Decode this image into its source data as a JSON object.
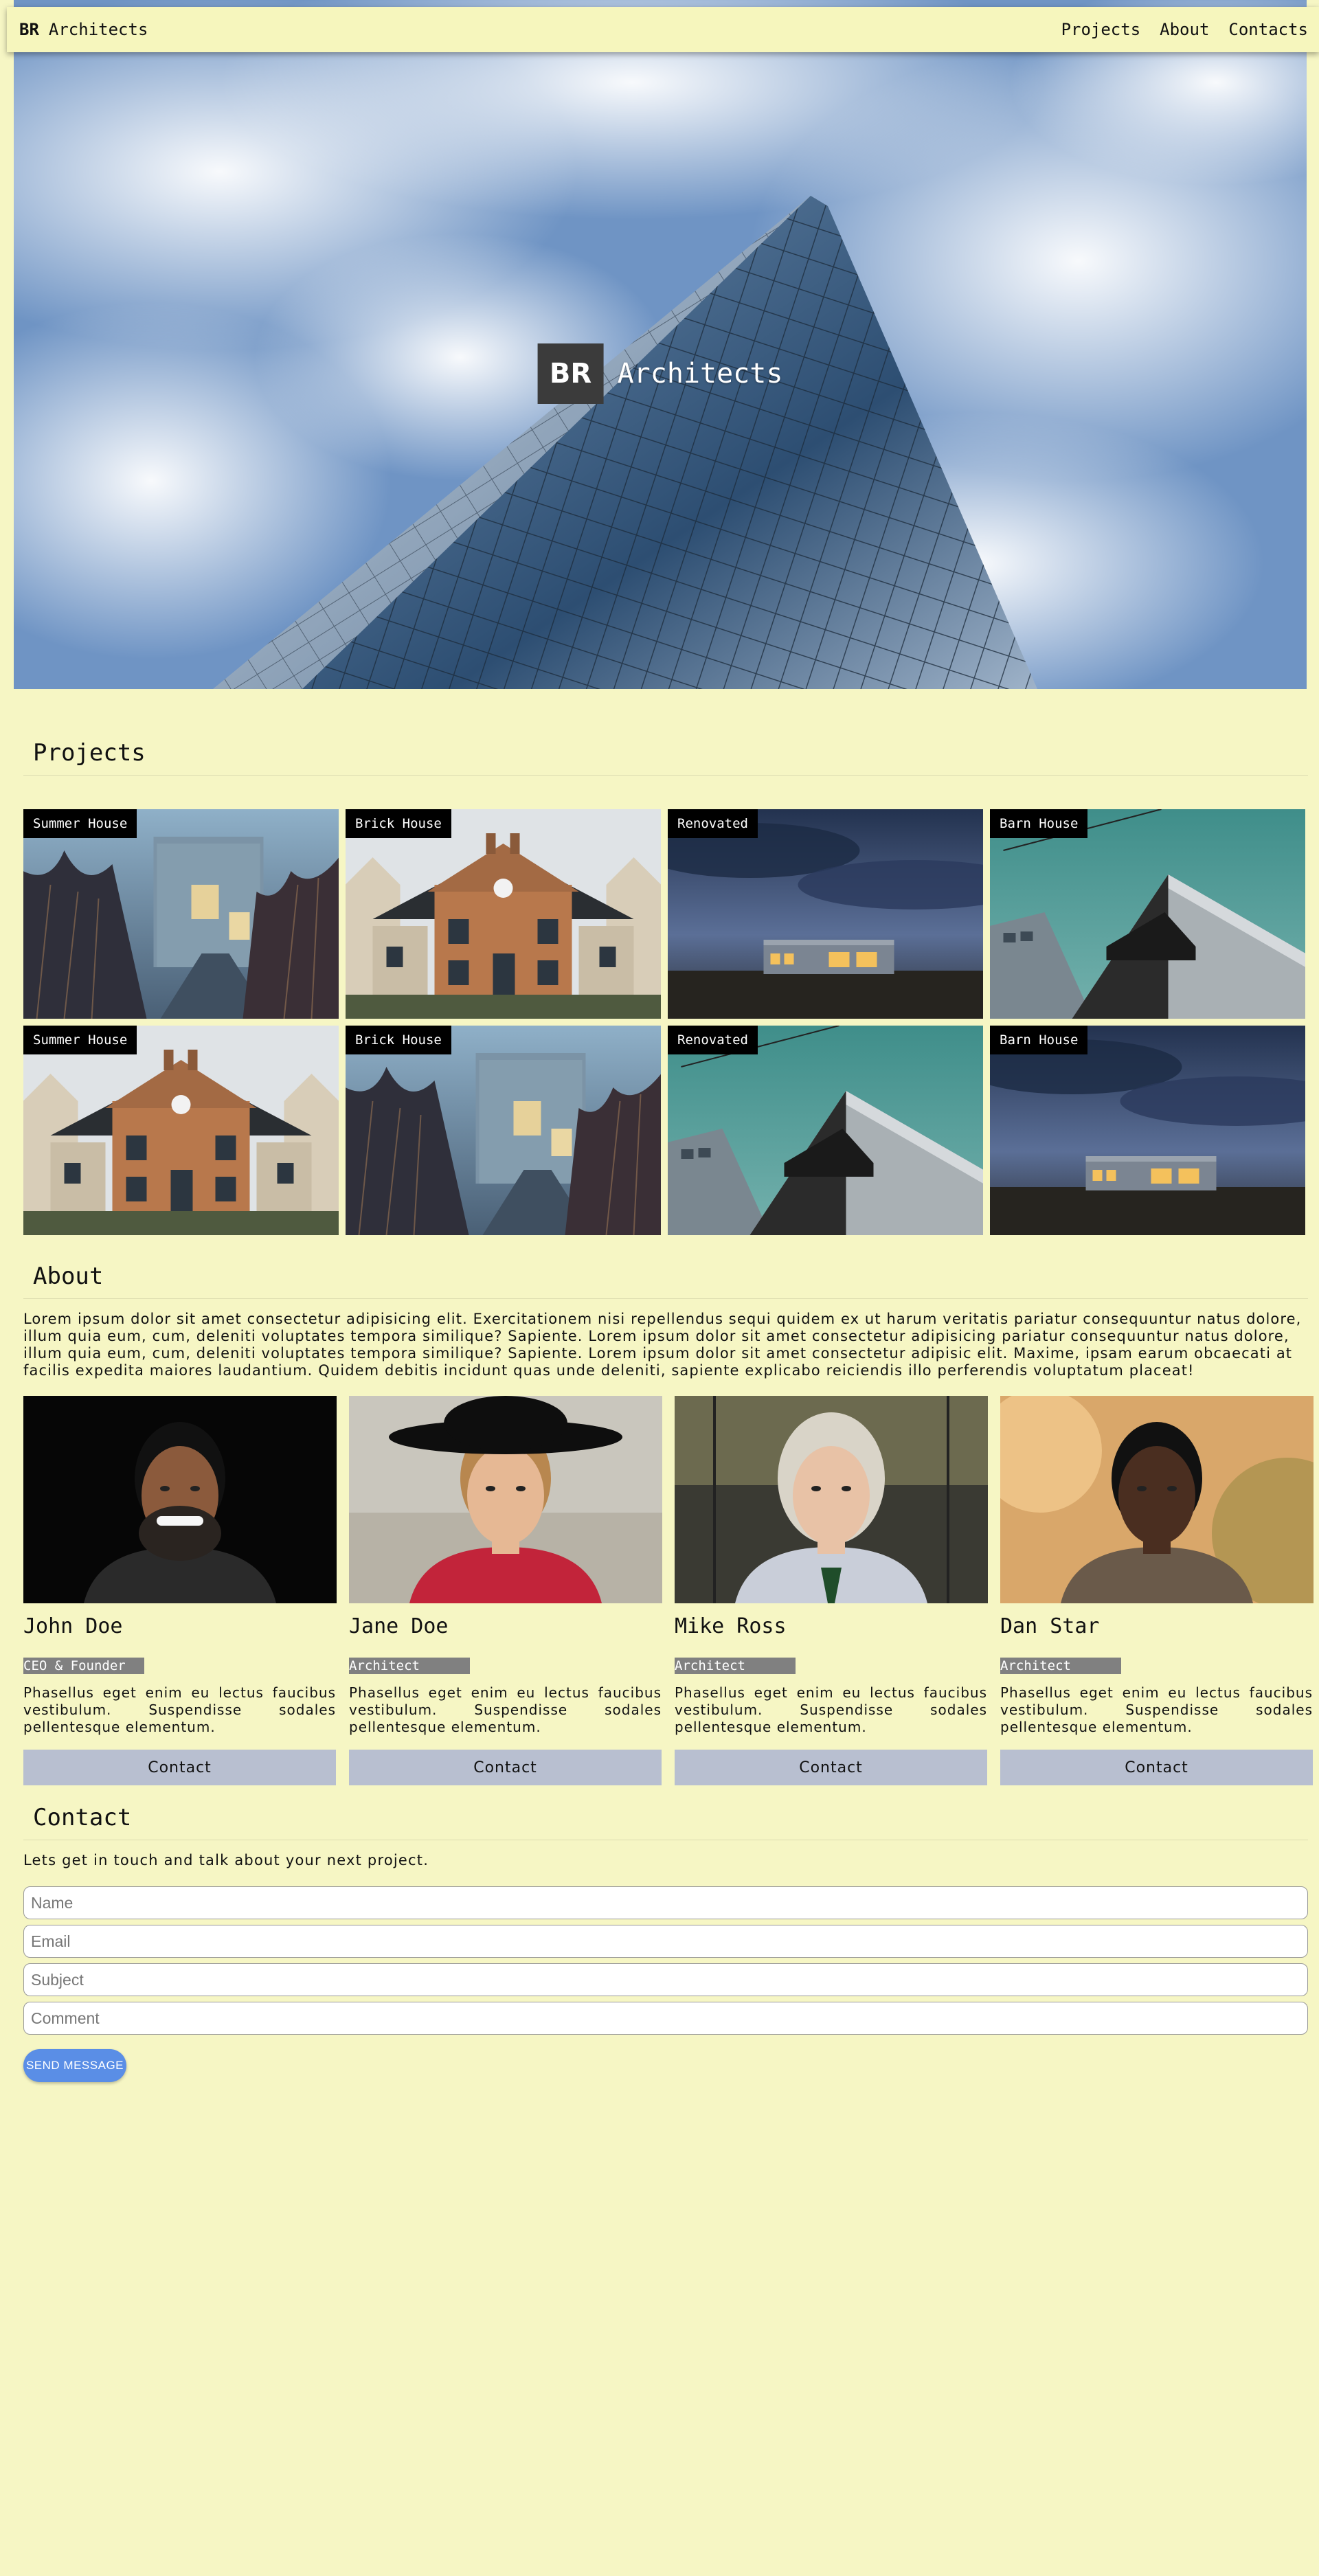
{
  "nav": {
    "brand_mark": "BR",
    "brand_name": "Architects",
    "links": [
      "Projects",
      "About",
      "Contacts"
    ]
  },
  "hero": {
    "mark": "BR",
    "title": "Architects"
  },
  "projects": {
    "title": "Projects",
    "tiles": [
      {
        "label": "Summer House",
        "image": "modern-house-path-photo"
      },
      {
        "label": "Brick House",
        "image": "brick-house-photo"
      },
      {
        "label": "Renovated",
        "image": "night-house-photo"
      },
      {
        "label": "Barn House",
        "image": "barn-house-photo"
      },
      {
        "label": "Summer House",
        "image": "brick-house-photo"
      },
      {
        "label": "Brick House",
        "image": "modern-house-path-photo"
      },
      {
        "label": "Renovated",
        "image": "barn-house-photo"
      },
      {
        "label": "Barn House",
        "image": "night-house-photo"
      }
    ]
  },
  "about": {
    "title": "About",
    "text": "Lorem ipsum dolor sit amet consectetur adipisicing elit. Exercitationem nisi repellendus sequi quidem ex ut harum veritatis pariatur consequuntur natus dolore, illum quia eum, cum, deleniti voluptates tempora similique? Sapiente. Lorem ipsum dolor sit amet consectetur adipisicing pariatur consequuntur natus dolore, illum quia eum, cum, deleniti voluptates tempora similique? Sapiente. Lorem ipsum dolor sit amet consectetur adipisic elit. Maxime, ipsam earum obcaecati at facilis expedita maiores laudantium. Quidem debitis incidunt quas unde deleniti, sapiente explicabo reiciendis illo perferendis voluptatum placeat!",
    "team": [
      {
        "name": "John Doe",
        "role": "CEO & Founder",
        "bio": "Phasellus eget enim eu lectus faucibus vestibulum. Suspendisse sodales pellentesque elementum.",
        "button": "Contact"
      },
      {
        "name": "Jane Doe",
        "role": "Architect",
        "bio": "Phasellus eget enim eu lectus faucibus vestibulum. Suspendisse sodales pellentesque elementum.",
        "button": "Contact"
      },
      {
        "name": "Mike Ross",
        "role": "Architect",
        "bio": "Phasellus eget enim eu lectus faucibus vestibulum. Suspendisse sodales pellentesque elementum.",
        "button": "Contact"
      },
      {
        "name": "Dan Star",
        "role": "Architect",
        "bio": "Phasellus eget enim eu lectus faucibus vestibulum. Suspendisse sodales pellentesque elementum.",
        "button": "Contact"
      }
    ]
  },
  "contact": {
    "title": "Contact",
    "lead": "Lets get in touch and talk about your next project.",
    "fields": {
      "name_placeholder": "Name",
      "email_placeholder": "Email",
      "subject_placeholder": "Subject",
      "comment_placeholder": "Comment"
    },
    "send_label": "SEND MESSAGE"
  },
  "colors": {
    "page_bg": "#f6f6c4",
    "nav_bg": "#f6f6bd",
    "button_blue": "#5a8ee6",
    "contact_button": "#b8bfd0",
    "role_badge": "#808080"
  }
}
